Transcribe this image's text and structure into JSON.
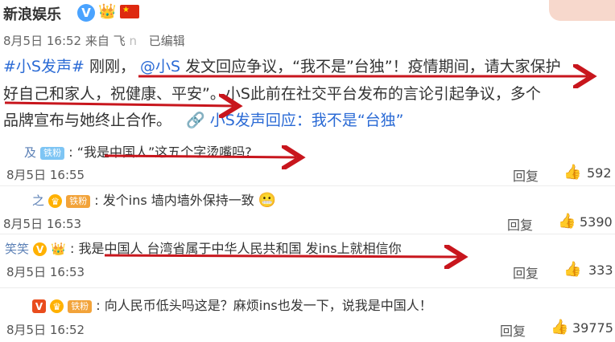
{
  "post": {
    "author": "新浪娱乐",
    "flag_icon": "china-flag-icon",
    "date": "8月5日 16:52",
    "source_prefix": "来自",
    "source_name": "飞",
    "source_tail": "n",
    "edited": "已编辑",
    "hashtag": "#小S发声#",
    "text_a": "刚刚，",
    "mention": "@小S",
    "text_b": "发文回应争议，“我不是”台独”！疫情期间，请大家保护",
    "line2": "好自己和家人，祝健康、平安”。小S此前在社交平台发布的言论引起争议，多个",
    "line3": "品牌宣布与她终止合作。",
    "link_text": "小S发声回应：我不是“台独”"
  },
  "comments": [
    {
      "username": "及",
      "badge": "铁粉",
      "text": "“我是中国人”这五个字烫嘴吗?",
      "time": "8月5日 16:55",
      "reply_label": "回复",
      "likes": "592"
    },
    {
      "username": "之",
      "badge": "铁粉",
      "text": "发个ins 墙内墙外保持一致",
      "time": "8月5日 16:53",
      "reply_label": "回复",
      "likes": "5390"
    },
    {
      "username": "笑笑",
      "badge": "",
      "text": "我是中国人 台湾省属于中华人民共和国 发ins上就相信你",
      "time": "8月5日 16:53",
      "reply_label": "回复",
      "likes": "333"
    },
    {
      "username": "",
      "badge": "铁粉",
      "text": "向人民币低头吗这是？麻烦ins也发一下，说我是中国人！",
      "time": "8月5日 16:52",
      "reply_label": "回复",
      "likes": "39775"
    }
  ],
  "colors": {
    "arrow": "#c8161d",
    "link": "#2a6ad5"
  }
}
